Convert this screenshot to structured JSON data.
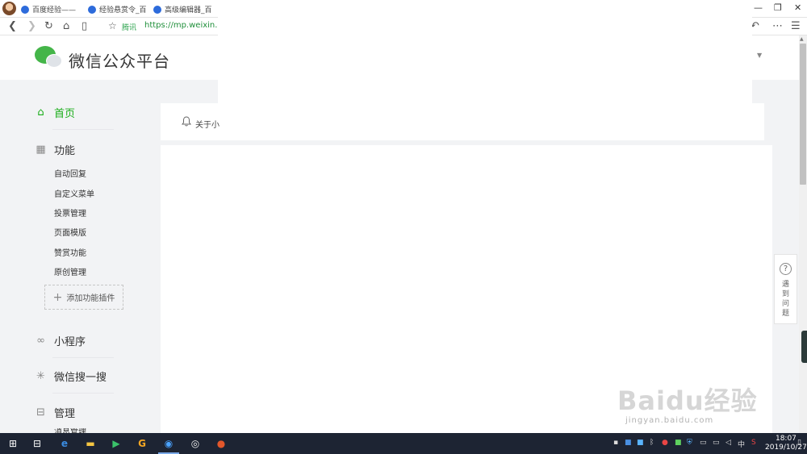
{
  "browser": {
    "tabs": [
      {
        "label": "百度经验——"
      },
      {
        "label": "经验悬赏令_百"
      },
      {
        "label": "高级编辑器_百"
      }
    ],
    "address_tag": "腾讯",
    "url": "https://mp.weixin.qq."
  },
  "header": {
    "brand": "微信公众平台"
  },
  "sidebar": {
    "home": "首页",
    "features": "功能",
    "feature_items": [
      "自动回复",
      "自定义菜单",
      "投票管理",
      "页面模版",
      "赞赏功能",
      "原创管理"
    ],
    "add_plugin": "添加功能插件",
    "mini_program": "小程序",
    "search": "微信搜一搜",
    "manage": "管理",
    "partial_item": "消息管理"
  },
  "notice": {
    "text": "关于小"
  },
  "help": {
    "text": "遇到问题"
  },
  "watermark": {
    "main": "Baidu经验",
    "sub": "jingyan.baidu.com"
  },
  "taskbar": {
    "ime": "中",
    "time": "18:07",
    "date": "2019/10/27"
  },
  "colors": {
    "accent": "#1aad19",
    "taskbar": "#1d2433"
  }
}
